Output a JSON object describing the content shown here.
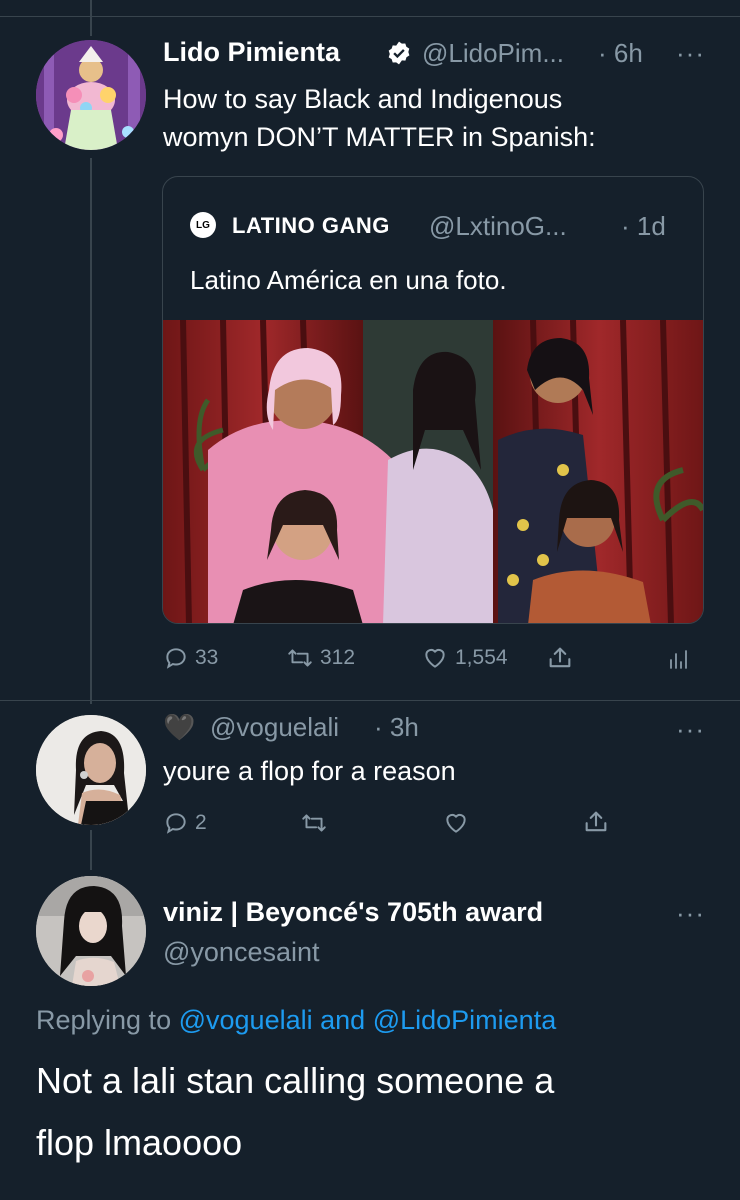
{
  "tweet1": {
    "display_name": "Lido Pimienta",
    "handle": "@LidoPim...",
    "time": "· 6h",
    "text_line1": "How to say Black and Indigenous",
    "text_line2": "womyn DON’T MATTER in Spanish:",
    "quote": {
      "logo_text": "LG",
      "display_name": "LATINO GANG",
      "handle": "@LxtinoG...",
      "time": "· 1d",
      "text": "Latino América en una foto."
    },
    "actions": {
      "replies": "33",
      "retweets": "312",
      "likes": "1,554"
    }
  },
  "tweet2": {
    "display_name_emoji": "🖤",
    "handle": "@voguelali",
    "time": "· 3h",
    "text": "youre a flop for a reason",
    "actions": {
      "replies": "2"
    }
  },
  "tweet3": {
    "display_name": "viniz | Beyoncé's 705th award",
    "handle": "@yoncesaint",
    "replying_prefix": "Replying to",
    "reply_to_1": "@voguelali",
    "reply_and": "and",
    "reply_to_2": "@LidoPimienta",
    "text_line1": "Not a lali stan calling someone a",
    "text_line2": "flop lmaoooo"
  },
  "colors": {
    "background": "#15202b",
    "muted": "#8899a6",
    "link": "#1d9bf0",
    "border": "#38444d"
  }
}
